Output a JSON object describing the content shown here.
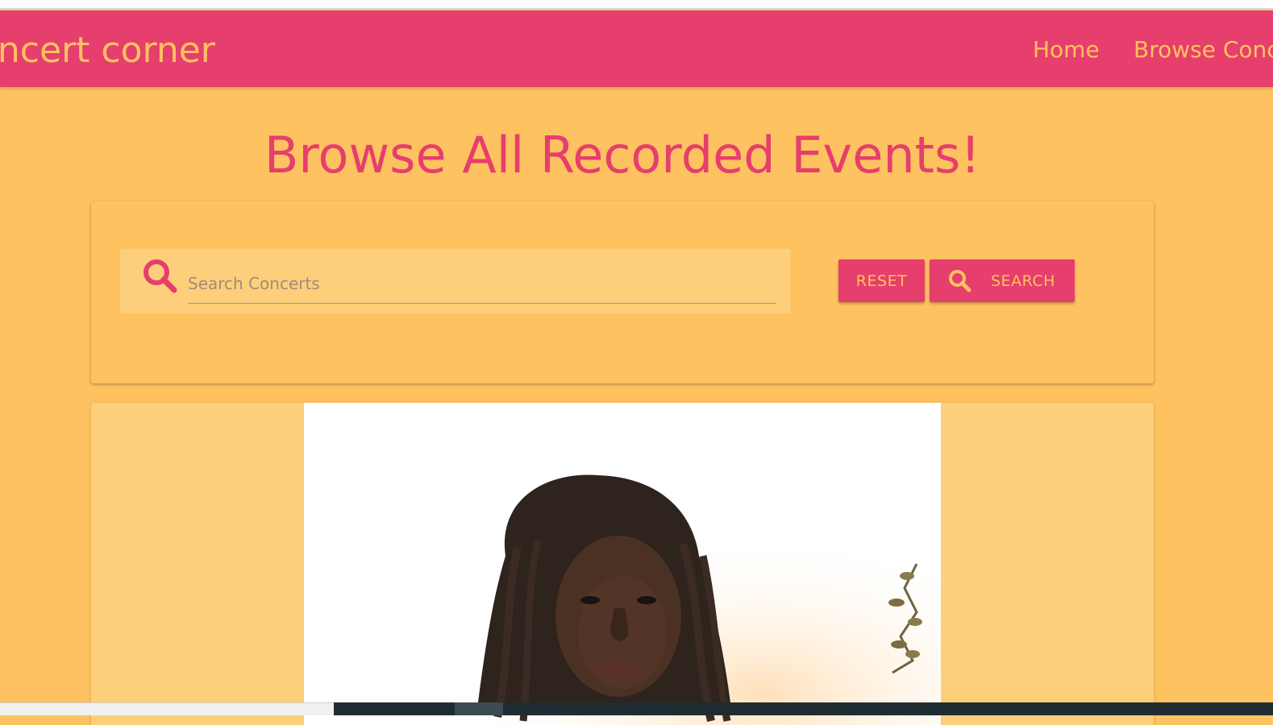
{
  "navbar": {
    "brand": "oncert corner",
    "links": [
      "Home",
      "Browse Conc"
    ]
  },
  "page": {
    "title": "Browse All Recorded Events!"
  },
  "search": {
    "placeholder": "Search Concerts",
    "reset_label": "RESET",
    "search_label": "SEARCH"
  },
  "colors": {
    "primary": "#e63e6d",
    "accent": "#fec260",
    "surface": "#fecf7a"
  },
  "icons": {
    "search_field": "search-icon",
    "search_button": "search-icon"
  }
}
